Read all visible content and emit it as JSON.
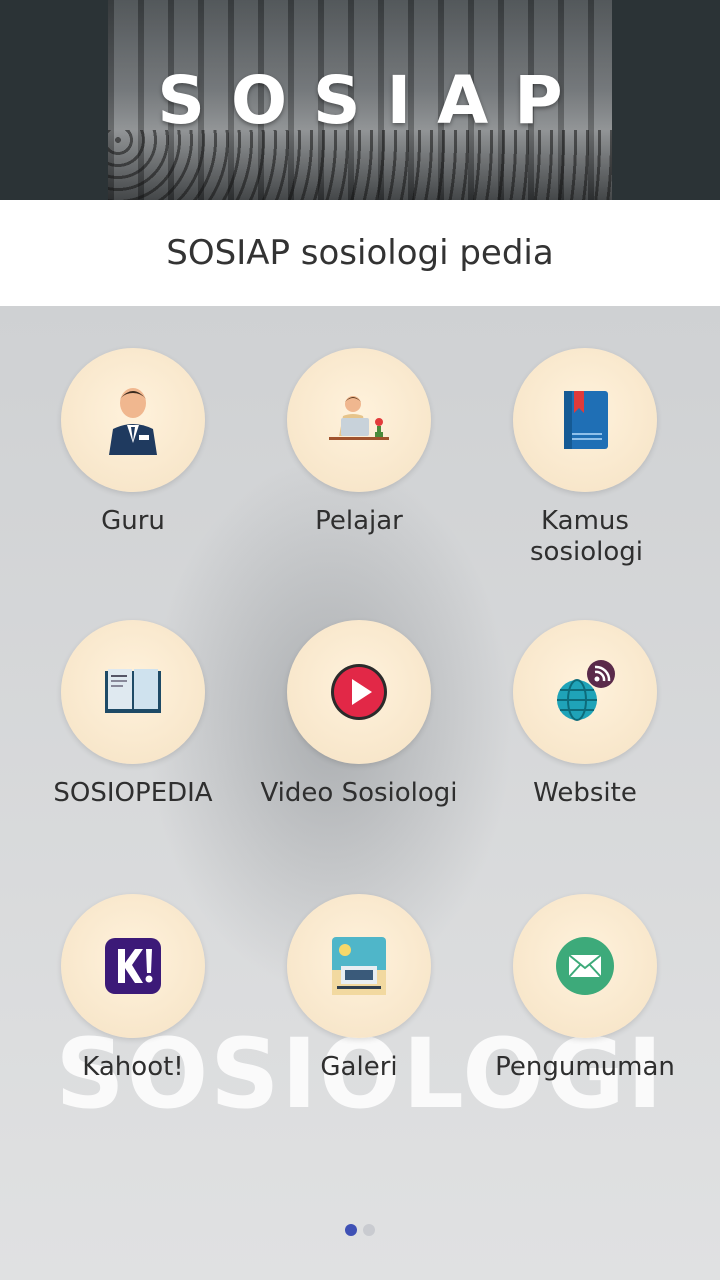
{
  "banner": {
    "title": "SOSIAP"
  },
  "header": {
    "subtitle": "SOSIAP sosiologi pedia"
  },
  "watermark": "SOSIOLOGI",
  "menu": [
    {
      "label": "Guru",
      "icon": "teacher-icon"
    },
    {
      "label": "Pelajar",
      "icon": "student-desk-icon"
    },
    {
      "label": "Kamus sosiologi",
      "icon": "dictionary-book-icon"
    },
    {
      "label": "SOSIOPEDIA",
      "icon": "open-book-icon"
    },
    {
      "label": "Video Sosiologi",
      "icon": "play-video-icon"
    },
    {
      "label": "Website",
      "icon": "globe-rss-icon"
    },
    {
      "label": "Kahoot!",
      "icon": "kahoot-icon"
    },
    {
      "label": "Galeri",
      "icon": "gallery-icon"
    },
    {
      "label": "Pengumuman",
      "icon": "mail-icon"
    }
  ],
  "pager": {
    "pages": 2,
    "current": 1
  },
  "colors": {
    "accent": "#3f51b5",
    "circle": "#f8e6c8",
    "banner": "#2b3336"
  }
}
